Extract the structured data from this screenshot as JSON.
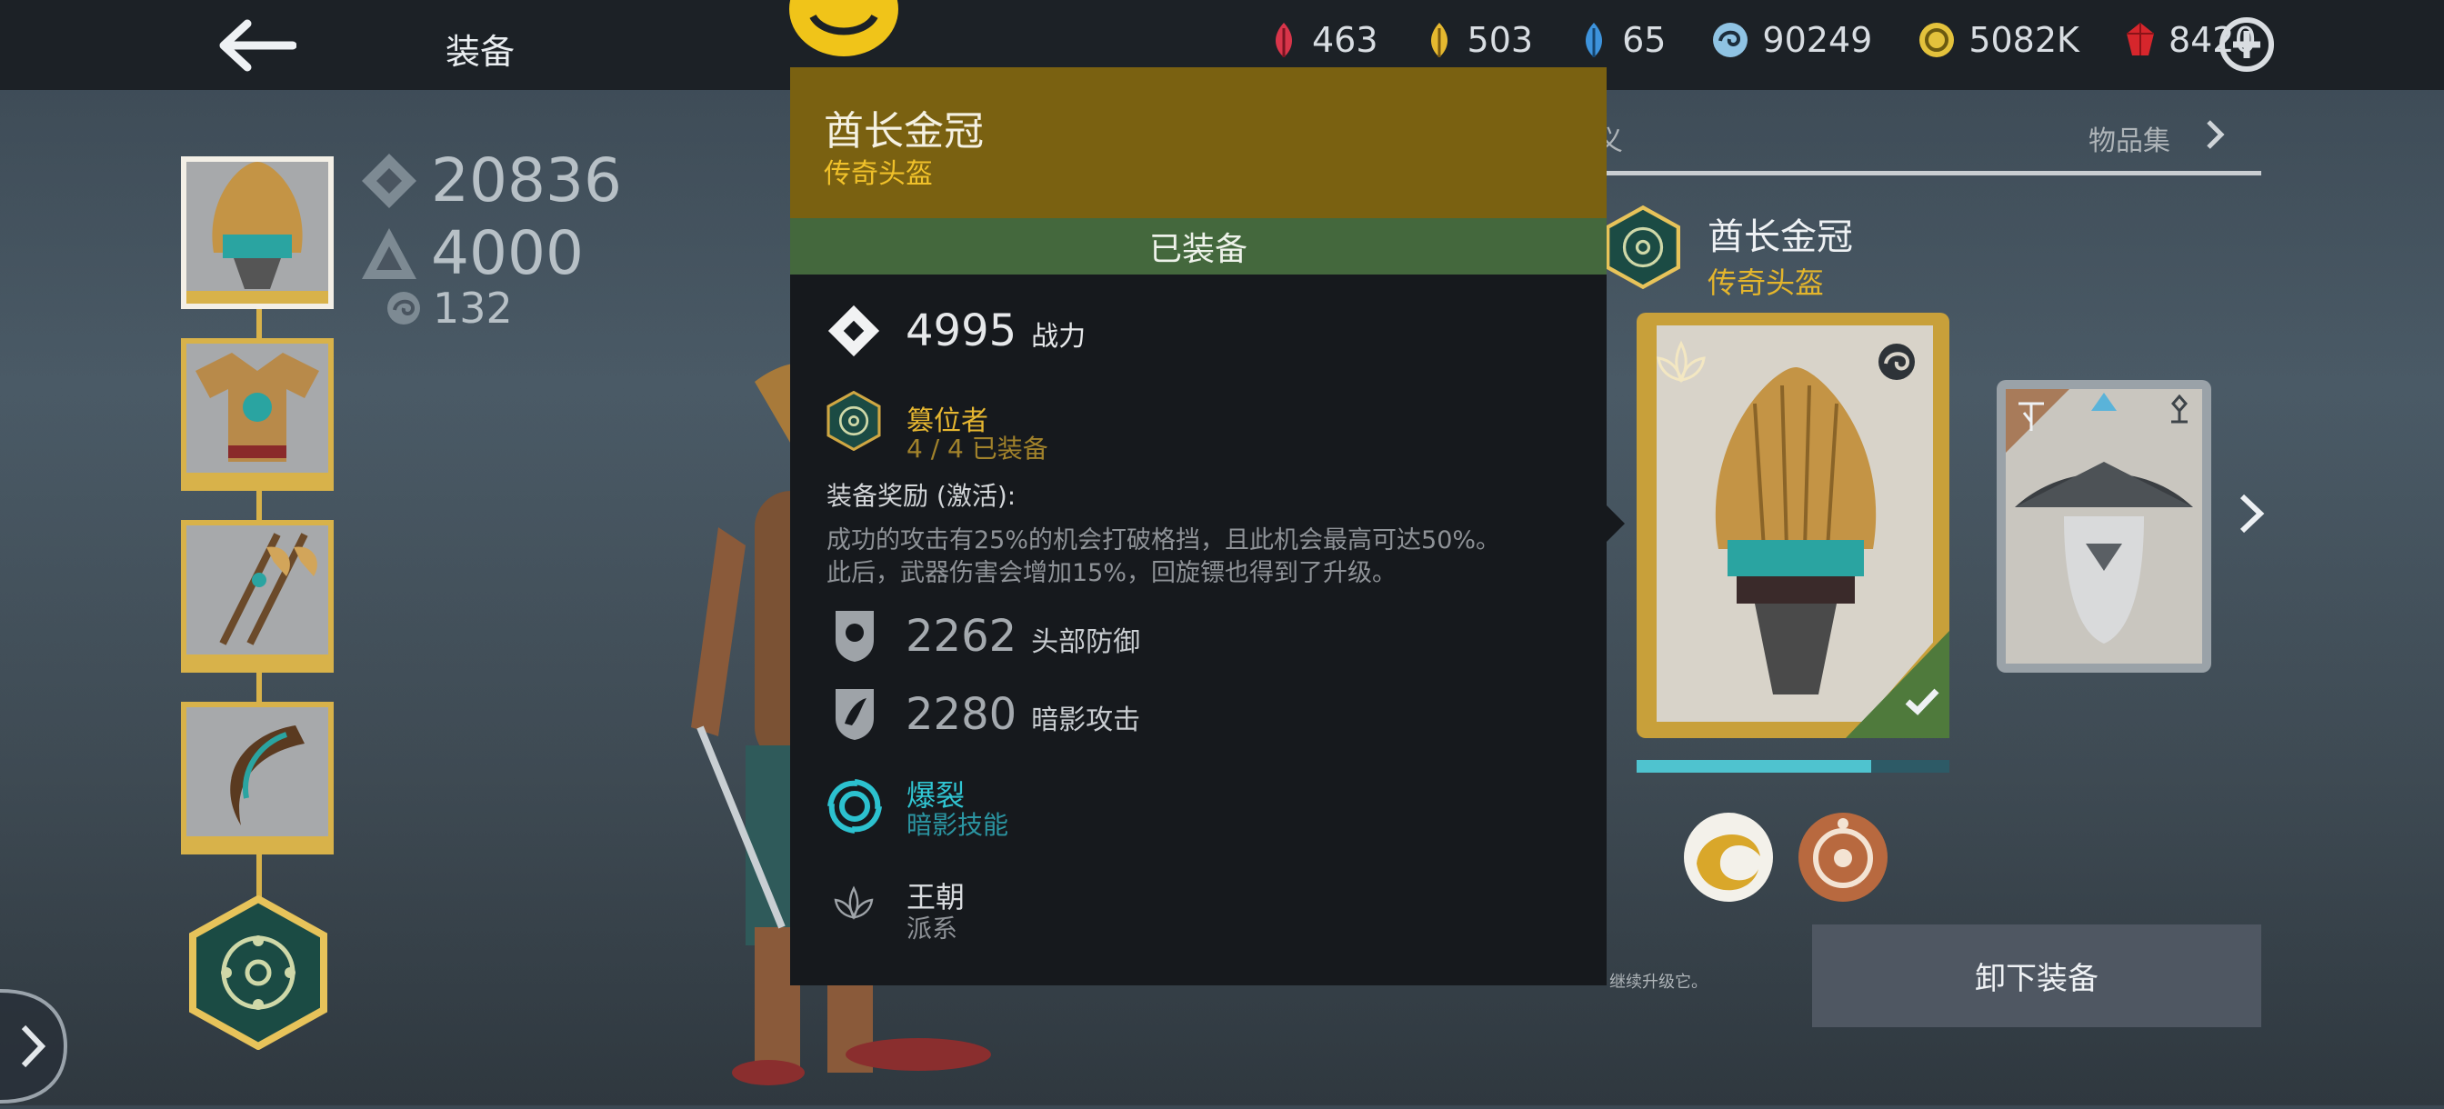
{
  "header": {
    "title": "装备",
    "currencies": [
      {
        "icon": "red-feather-icon",
        "value": "463",
        "color": "#d8354a"
      },
      {
        "icon": "gold-feather-icon",
        "value": "503",
        "color": "#e5b82f"
      },
      {
        "icon": "blue-feather-icon",
        "value": "65",
        "color": "#3d93dc"
      },
      {
        "icon": "blue-orb-icon",
        "value": "90249",
        "color": "#8fc3e3"
      },
      {
        "icon": "gold-coin-icon",
        "value": "5082K",
        "color": "#e3c23c"
      },
      {
        "icon": "ruby-icon",
        "value": "8420",
        "color": "#d6262c"
      }
    ]
  },
  "stats": {
    "power": "20836",
    "defense": "4000",
    "level": "132"
  },
  "tabs": {
    "equip": "装备",
    "partial": "义",
    "collection": "物品集"
  },
  "item": {
    "name": "酋长金冠",
    "subtitle": "传奇头盔",
    "equipped_label": "已装备",
    "power_value": "4995",
    "power_label": "战力",
    "set_name": "篡位者",
    "set_count": "4 / 4 已装备",
    "bonus_title": "装备奖励 (激活):",
    "bonus_line1": "成功的攻击有25%的机会打破格挡，且此机会最高可达50%。",
    "bonus_line2": "此后，武器伤害会增加15%，回旋镖也得到了升级。",
    "head_def_value": "2262",
    "head_def_label": "头部防御",
    "shadow_atk_value": "2280",
    "shadow_atk_label": "暗影攻击",
    "skill_name": "爆裂",
    "skill_type": "暗影技能",
    "faction_name": "王朝",
    "faction_type": "派系"
  },
  "right": {
    "bg_power": "4995",
    "footnote": "继续升级它。",
    "unequip_label": "卸下装备",
    "progress": 0.75
  }
}
